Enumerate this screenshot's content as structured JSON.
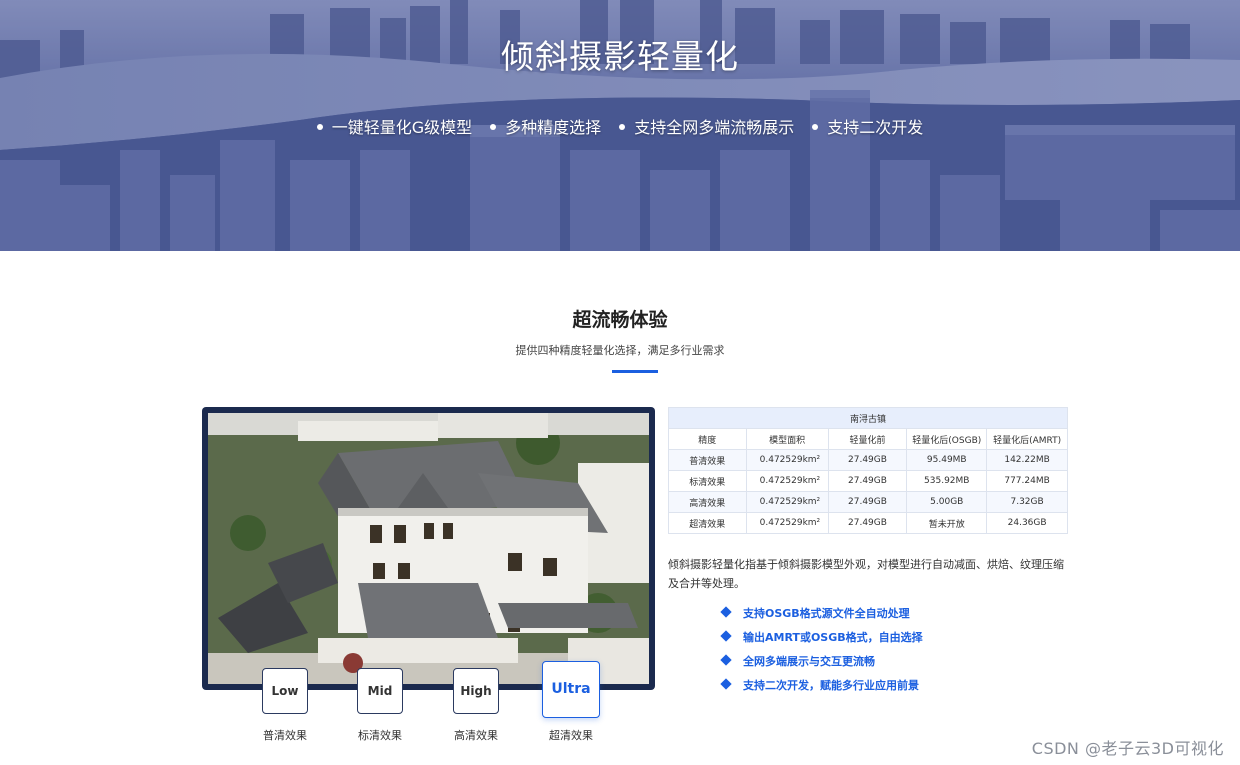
{
  "hero": {
    "title": "倾斜摄影轻量化",
    "features": [
      "一键轻量化G级模型",
      "多种精度选择",
      "支持全网多端流畅展示",
      "支持二次开发"
    ]
  },
  "section": {
    "title": "超流畅体验",
    "subtitle": "提供四种精度轻量化选择，满足多行业需求"
  },
  "levels": [
    {
      "label": "Low",
      "caption": "普清效果"
    },
    {
      "label": "Mid",
      "caption": "标清效果"
    },
    {
      "label": "High",
      "caption": "高清效果"
    },
    {
      "label": "Ultra",
      "caption": "超清效果",
      "active": true
    }
  ],
  "table": {
    "caption": "南浔古镇",
    "headers": [
      "精度",
      "模型面积",
      "轻量化前",
      "轻量化后(OSGB)",
      "轻量化后(AMRT)"
    ],
    "rows": [
      [
        "普清效果",
        "0.472529km²",
        "27.49GB",
        "95.49MB",
        "142.22MB"
      ],
      [
        "标清效果",
        "0.472529km²",
        "27.49GB",
        "535.92MB",
        "777.24MB"
      ],
      [
        "高清效果",
        "0.472529km²",
        "27.49GB",
        "5.00GB",
        "7.32GB"
      ],
      [
        "超清效果",
        "0.472529km²",
        "27.49GB",
        "暂未开放",
        "24.36GB"
      ]
    ]
  },
  "description": "倾斜摄影轻量化指基于倾斜摄影模型外观，对模型进行自动减面、烘焙、纹理压缩及合并等处理。",
  "bullets": [
    "支持OSGB格式源文件全自动处理",
    "输出AMRT或OSGB格式，自由选择",
    "全网多端展示与交互更流畅",
    "支持二次开发，赋能多行业应用前景"
  ],
  "watermark": "CSDN @老子云3D可视化",
  "colors": {
    "accent": "#1b5fe0",
    "hero_overlay": "#4b5a92",
    "viewer_frame": "#1b2a4e"
  }
}
